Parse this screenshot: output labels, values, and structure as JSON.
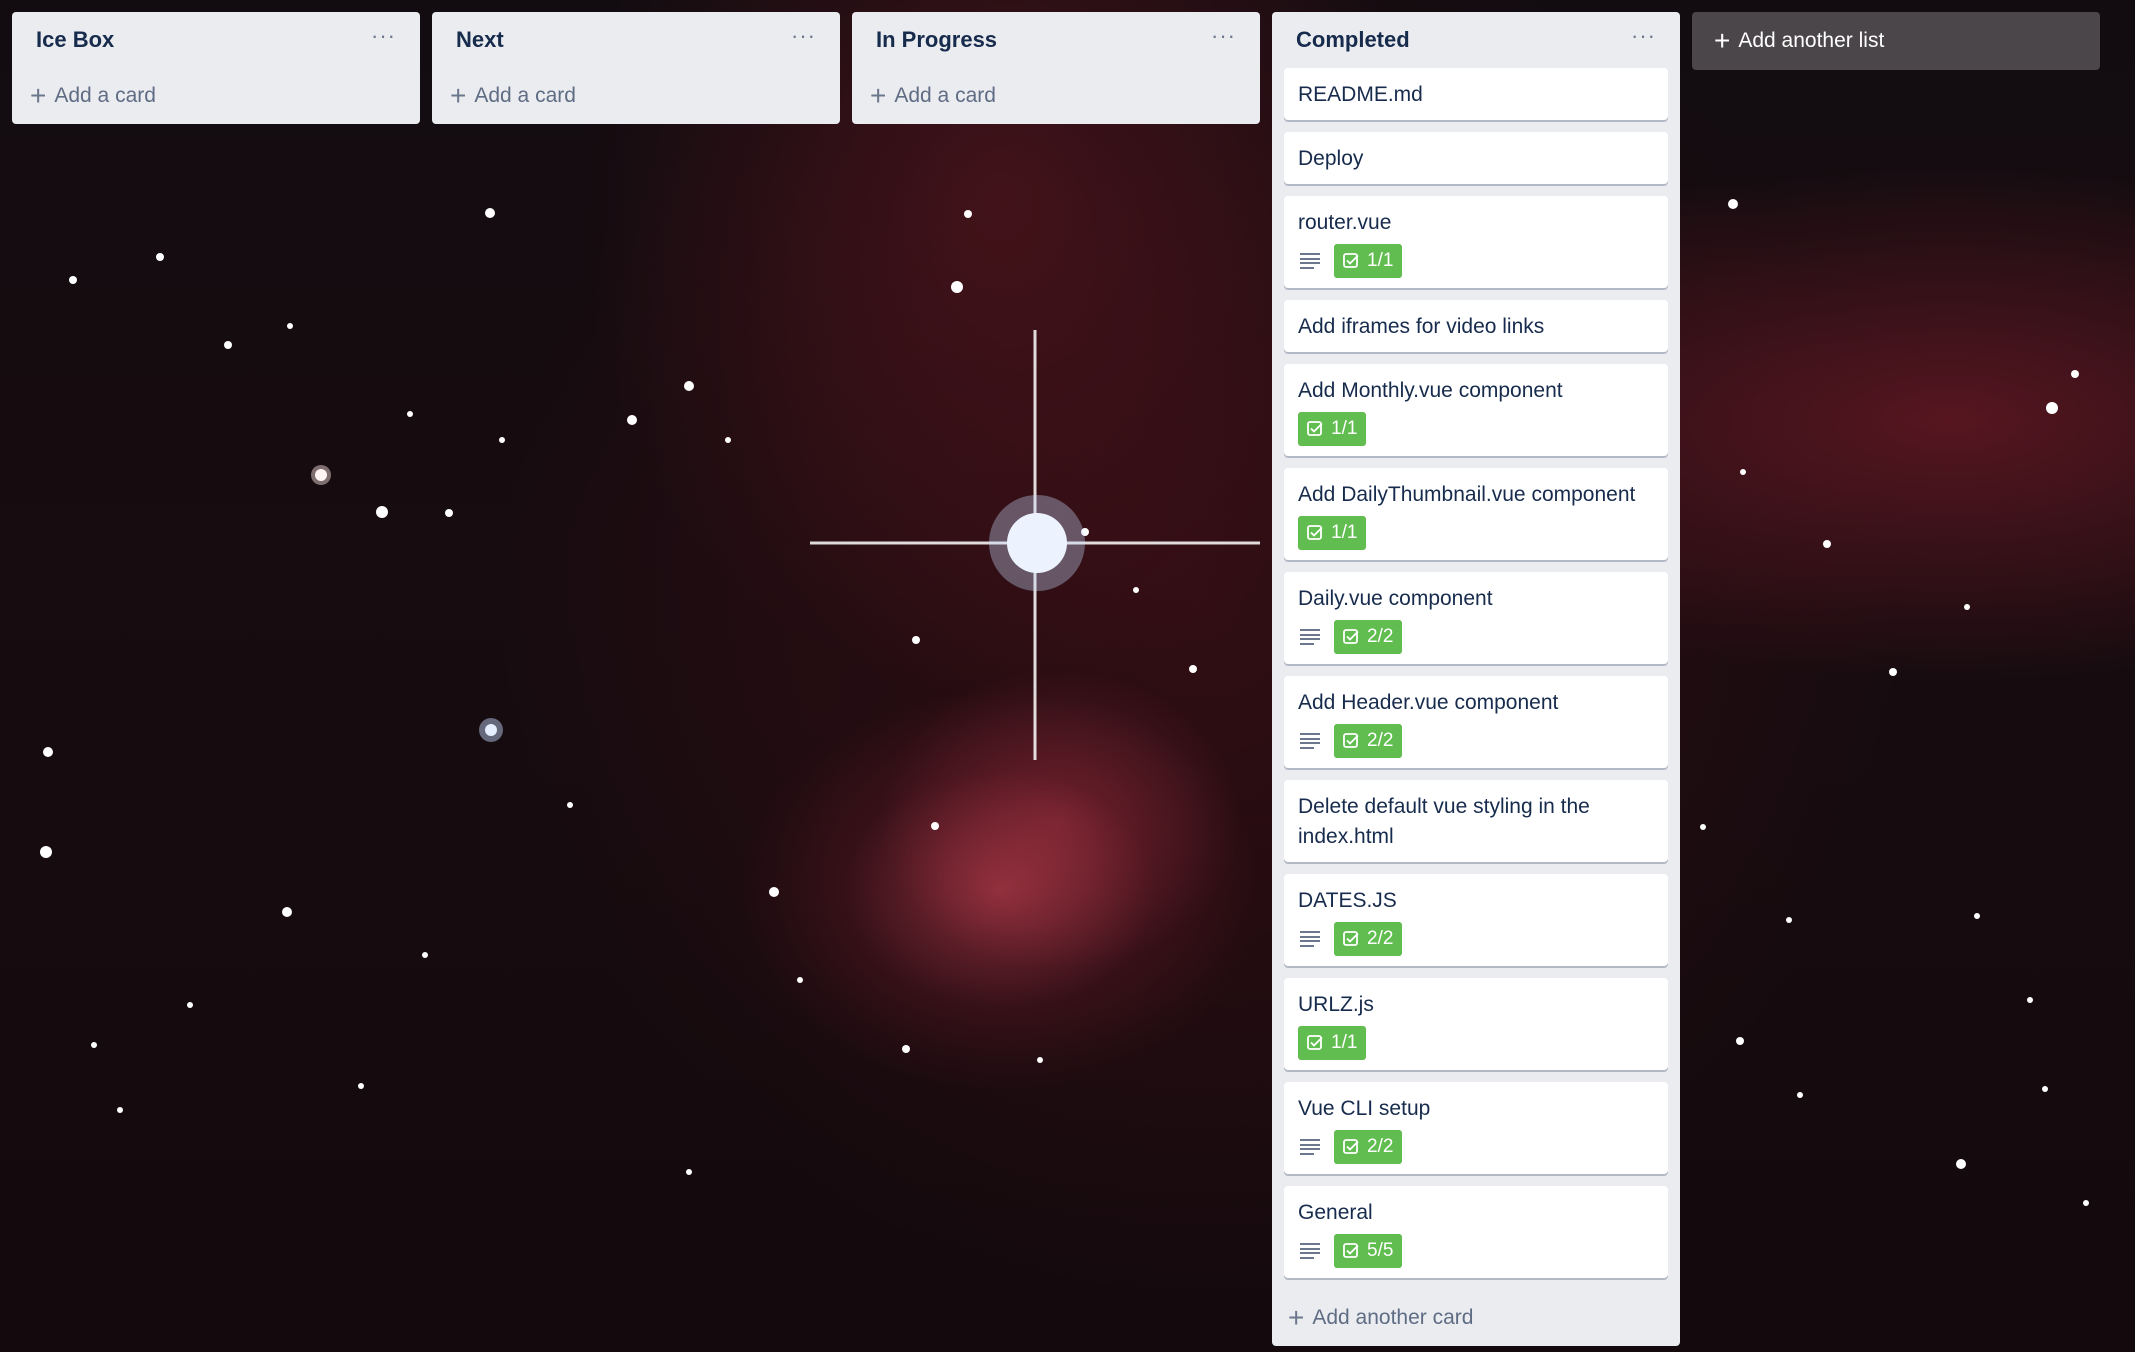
{
  "colors": {
    "list_bg": "#ebecf0",
    "badge_green": "#61bd4f",
    "text_primary": "#172b4d",
    "text_secondary": "#5e6c84"
  },
  "icons": {
    "plus": "+",
    "menu": "···",
    "description": "description-icon",
    "checklist": "checkbox-icon"
  },
  "lists": [
    {
      "title": "Ice Box",
      "add_label": "Add a card"
    },
    {
      "title": "Next",
      "add_label": "Add a card"
    },
    {
      "title": "In Progress",
      "add_label": "Add a card"
    }
  ],
  "completed": {
    "title": "Completed",
    "add_label": "Add another card",
    "cards": [
      {
        "title": "README.md"
      },
      {
        "title": "Deploy"
      },
      {
        "title": "router.vue",
        "has_description": true,
        "checklist": "1/1"
      },
      {
        "title": "Add iframes for video links"
      },
      {
        "title": "Add Monthly.vue component",
        "checklist": "1/1"
      },
      {
        "title": "Add DailyThumbnail.vue component",
        "checklist": "1/1"
      },
      {
        "title": "Daily.vue component",
        "has_description": true,
        "checklist": "2/2"
      },
      {
        "title": "Add Header.vue component",
        "has_description": true,
        "checklist": "2/2"
      },
      {
        "title": "Delete default vue styling in the index.html"
      },
      {
        "title": "DATES.JS",
        "has_description": true,
        "checklist": "2/2"
      },
      {
        "title": "URLZ.js",
        "checklist": "1/1"
      },
      {
        "title": "Vue CLI setup",
        "has_description": true,
        "checklist": "2/2"
      },
      {
        "title": "General",
        "has_description": true,
        "checklist": "5/5"
      }
    ]
  },
  "add_list_label": "Add another list"
}
